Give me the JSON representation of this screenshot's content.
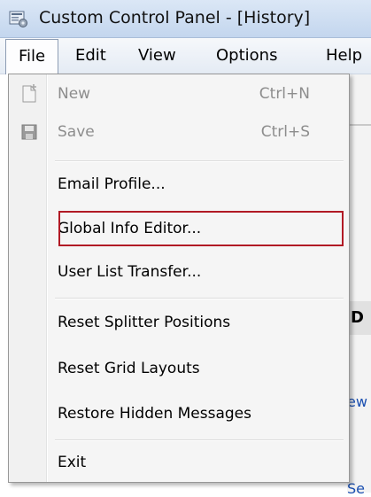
{
  "window": {
    "title": "Custom Control Panel - [History]"
  },
  "menubar": {
    "items": [
      {
        "label": "File",
        "active": true
      },
      {
        "label": "Edit"
      },
      {
        "label": "View"
      },
      {
        "label": "Options"
      },
      {
        "label": "Help"
      }
    ]
  },
  "file_menu": {
    "items": [
      {
        "label": "New",
        "shortcut": "Ctrl+N",
        "enabled": false,
        "icon": "new-file-icon"
      },
      {
        "label": "Save",
        "shortcut": "Ctrl+S",
        "enabled": false,
        "icon": "save-disk-icon"
      },
      {
        "label": "Email Profile...",
        "enabled": true
      },
      {
        "label": "Global Info Editor...",
        "enabled": true,
        "highlighted": true
      },
      {
        "label": "User List Transfer...",
        "enabled": true
      },
      {
        "label": "Reset Splitter Positions",
        "enabled": true
      },
      {
        "label": "Reset Grid Layouts",
        "enabled": true
      },
      {
        "label": "Restore Hidden Messages",
        "enabled": true
      },
      {
        "label": "Exit",
        "enabled": true
      }
    ]
  },
  "background": {
    "fragment_1": "D",
    "fragment_2": "ew",
    "fragment_3": "Se"
  },
  "colors": {
    "highlight_border": "#b11a25",
    "disabled_text": "#8d8d8d"
  }
}
